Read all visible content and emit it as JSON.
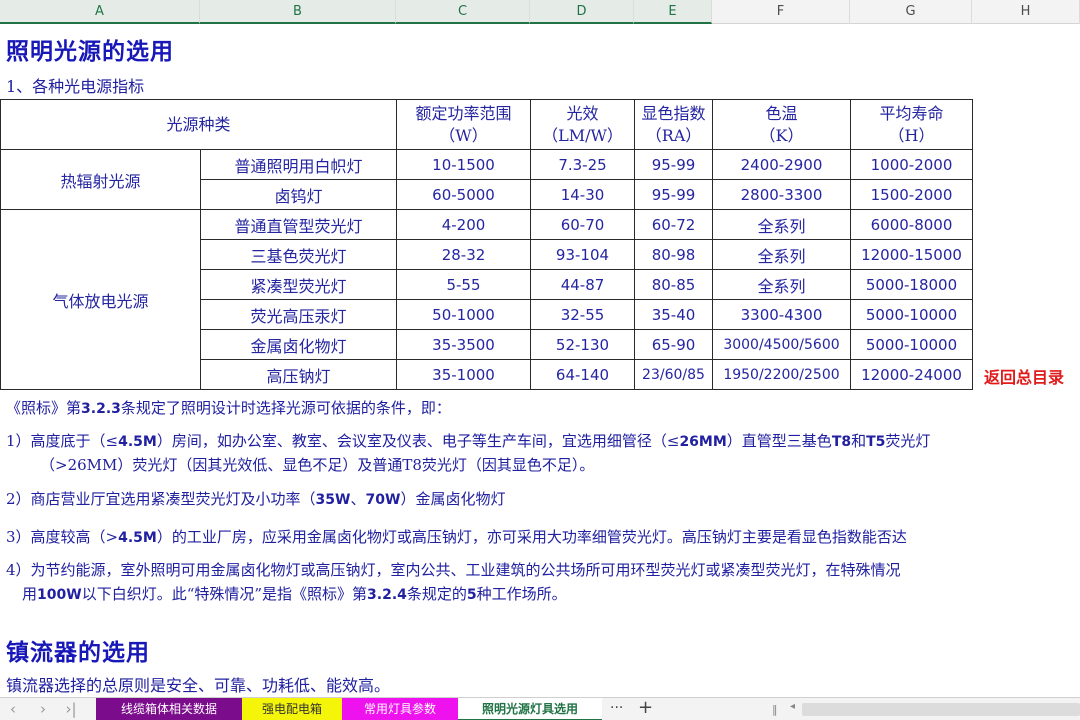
{
  "columns": [
    {
      "label": "A",
      "selected": true
    },
    {
      "label": "B",
      "selected": true
    },
    {
      "label": "C",
      "selected": true
    },
    {
      "label": "D",
      "selected": true
    },
    {
      "label": "E",
      "selected": true
    },
    {
      "label": "F",
      "selected": false
    },
    {
      "label": "G",
      "selected": false
    },
    {
      "label": "H",
      "selected": false
    }
  ],
  "title1": "照明光源的选用",
  "subtitle1": "1、各种光电源指标",
  "table": {
    "header": {
      "type": "光源种类",
      "power": "额定功率范围",
      "power_unit": "（W）",
      "efficacy": "光效",
      "efficacy_unit": "（LM/W）",
      "cri": "显色指数",
      "cri_unit": "（RA）",
      "cct": "色温",
      "cct_unit": "（K）",
      "life": "平均寿命",
      "life_unit": "（H）"
    },
    "groups": [
      {
        "name": "热辐射光源",
        "rows": [
          {
            "name": "普通照明用白帜灯",
            "power": "10-1500",
            "efficacy": "7.3-25",
            "cri": "95-99",
            "cct": "2400-2900",
            "life": "1000-2000"
          },
          {
            "name": "卤钨灯",
            "power": "60-5000",
            "efficacy": "14-30",
            "cri": "95-99",
            "cct": "2800-3300",
            "life": "1500-2000"
          }
        ]
      },
      {
        "name": "气体放电光源",
        "rows": [
          {
            "name": "普通直管型荧光灯",
            "power": "4-200",
            "efficacy": "60-70",
            "cri": "60-72",
            "cct": "全系列",
            "life": "6000-8000"
          },
          {
            "name": "三基色荧光灯",
            "power": "28-32",
            "efficacy": "93-104",
            "cri": "80-98",
            "cct": "全系列",
            "life": "12000-15000"
          },
          {
            "name": "紧凑型荧光灯",
            "power": "5-55",
            "efficacy": "44-87",
            "cri": "80-85",
            "cct": "全系列",
            "life": "5000-18000"
          },
          {
            "name": "荧光高压汞灯",
            "power": "50-1000",
            "efficacy": "32-55",
            "cri": "35-40",
            "cct": "3300-4300",
            "life": "5000-10000"
          },
          {
            "name": "金属卤化物灯",
            "power": "35-3500",
            "efficacy": "52-130",
            "cri": "65-90",
            "cct": "3000/4500/5600",
            "life": "5000-10000"
          },
          {
            "name": "高压钠灯",
            "power": "35-1000",
            "efficacy": "64-140",
            "cri": "23/60/85",
            "cct": "1950/2200/2500",
            "life": "12000-24000"
          }
        ]
      }
    ]
  },
  "back_link": "返回总目录",
  "intro": {
    "a": "《照标》第",
    "b": "3.2.3",
    "c": "条规定了照明设计时选择光源可依据的条件，即："
  },
  "p1_line1": {
    "a": "1）高度底于（≤",
    "b": "4.5M",
    "c": "）房间，如办公室、教室、会议室及仪表、电子等生产车间，宜选用细管径（≤",
    "d": "26MM",
    "e": "）直管型三基色",
    "f": "T8",
    "g": "和",
    "h": "T5",
    "i": "荧光灯"
  },
  "p1_line2": "（>26MM）荧光灯（因其光效低、显色不足）及普通T8荧光灯（因其显色不足）。",
  "p2": {
    "a": "2）商店营业厅宜选用紧凑型荧光灯及小功率（",
    "b": "35W",
    "c": "、",
    "d": "70W",
    "e": "）金属卤化物灯"
  },
  "p3": {
    "a": "3）高度较高（>",
    "b": "4.5M",
    "c": "）的工业厂房，应采用金属卤化物灯或高压钠灯，亦可采用大功率细管荧光灯。高压钠灯主要是看显色指数能否达"
  },
  "p4_line1": "4）为节约能源，室外照明可用金属卤化物灯或高压钠灯，室内公共、工业建筑的公共场所可用环型荧光灯或紧凑型荧光灯，在特殊情况",
  "p4_line2": {
    "a": "用",
    "b": "100W",
    "c": "以下白织灯。此“特殊情况”是指《照标》第",
    "d": "3.2.4",
    "e": "条规定的",
    "f": "5",
    "g": "种工作场所。"
  },
  "title2": "镇流器的选用",
  "ballast_text": "镇流器选择的总原则是安全、可靠、功耗低、能效高。",
  "sheet_tabs": [
    {
      "label": "线缆箱体相关数据",
      "bg": "#7b0c8c",
      "fg": "#ffffff",
      "active": false
    },
    {
      "label": "强电配电箱",
      "bg": "#f5f50a",
      "fg": "#333333",
      "active": false
    },
    {
      "label": "常用灯具参数",
      "bg": "#ee12ee",
      "fg": "#ffffff",
      "active": false
    },
    {
      "label": "照明光源灯具选用",
      "bg": "#ffffff",
      "fg": "#217346",
      "active": true
    }
  ],
  "tab_more": "···",
  "tab_add": "+"
}
